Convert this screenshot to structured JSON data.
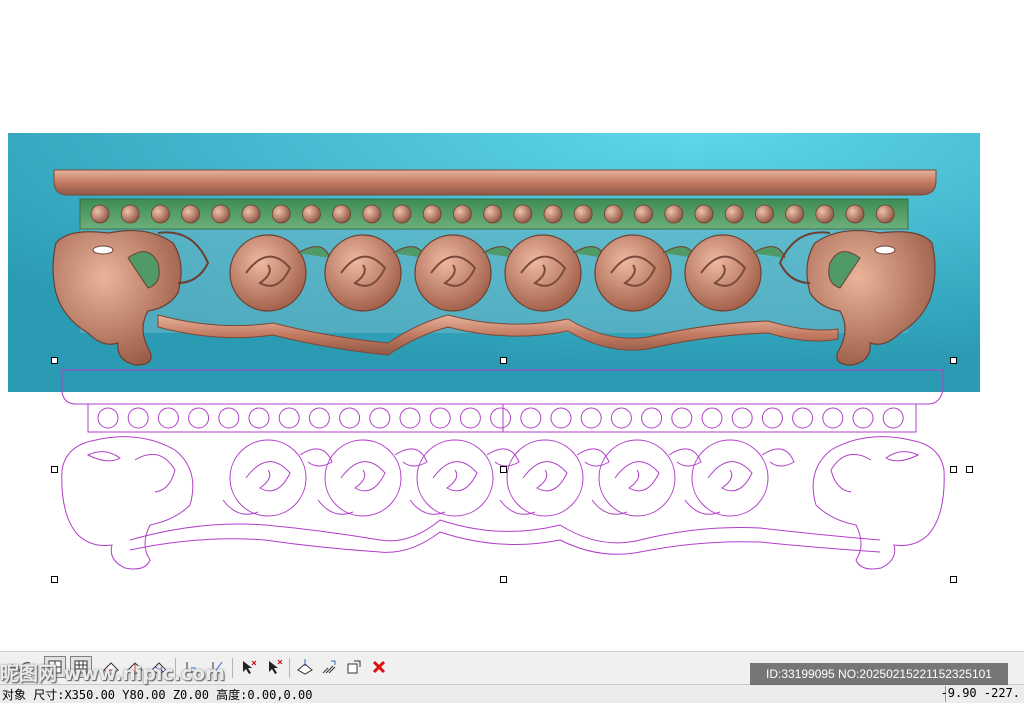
{
  "artwork": {
    "render_name": "carved-elephant-frieze-relief",
    "outline_name": "carved-elephant-frieze-vector-outline",
    "colors": {
      "background": "#34b0c6",
      "wood": "#c8826a",
      "beads": "#b37862",
      "band": "#4f9a66",
      "outline": "#b23fc9"
    }
  },
  "toolbar": {
    "buttons": [
      {
        "name": "arrow-tool-icon"
      },
      {
        "name": "curve-tool-icon"
      },
      {
        "name": "grid-view-icon",
        "pressed": true
      },
      {
        "name": "mesh-view-icon",
        "pressed": true
      },
      {
        "name": "shape-front-icon"
      },
      {
        "name": "shape-side-icon"
      },
      {
        "name": "shape-top-icon"
      },
      {
        "name": "align-bottom-icon"
      },
      {
        "name": "align-node-icon"
      },
      {
        "name": "pick-node-icon"
      },
      {
        "name": "delete-node-icon"
      },
      {
        "name": "transform-icon"
      },
      {
        "name": "magnet-icon"
      },
      {
        "name": "scale-icon"
      },
      {
        "name": "close-icon"
      }
    ]
  },
  "status": {
    "left": "对象 尺寸:X350.00 Y80.00 Z0.00 高度:0.00,0.00",
    "right": "-9.90 -227."
  },
  "watermark": {
    "left_text": "昵图网 www.nipic.com",
    "id_text": "ID:33199095 NO:20250215221152325101"
  }
}
